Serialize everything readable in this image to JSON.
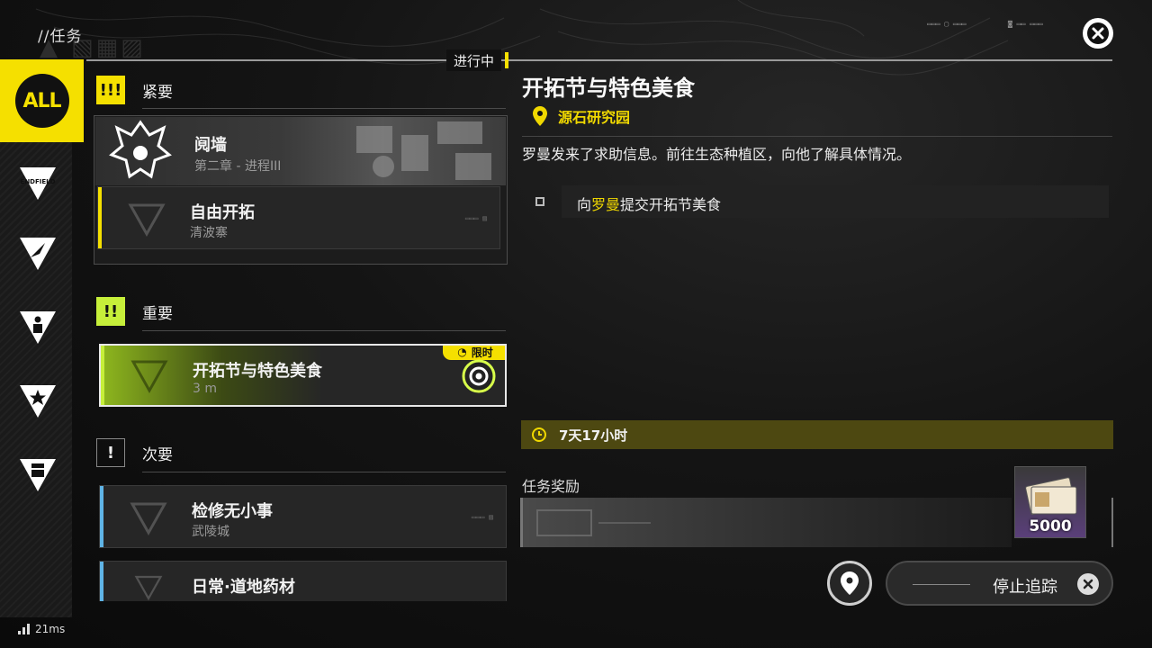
{
  "header": {
    "title": "//任务",
    "close_icon": "close-x-icon"
  },
  "status": {
    "in_progress": "进行中",
    "ping": "21ms"
  },
  "sidebar": {
    "all_label": "ALL",
    "items": [
      {
        "name": "endfield",
        "label": "ENDFIELD",
        "icon": "endfield-icon"
      },
      {
        "name": "explore",
        "icon": "compass-icon"
      },
      {
        "name": "character",
        "icon": "person-icon"
      },
      {
        "name": "event",
        "icon": "star-icon"
      },
      {
        "name": "daily",
        "icon": "box-icon"
      }
    ]
  },
  "groups": {
    "urgent": {
      "badge": "!!!",
      "label": "紧要"
    },
    "important": {
      "badge": "!!",
      "label": "重要"
    },
    "minor": {
      "badge": "!",
      "label": "次要"
    }
  },
  "quests": {
    "urgent_main": {
      "title": "阋墙",
      "subtitle": "第二章 - 进程III"
    },
    "urgent_sub": {
      "title": "自由开拓",
      "subtitle": "清波寨"
    },
    "important_1": {
      "title": "开拓节与特色美食",
      "subtitle": "3 m",
      "tag": "限时"
    },
    "minor_1": {
      "title": "检修无小事",
      "subtitle": "武陵城"
    },
    "minor_2": {
      "title": "日常·道地药材"
    }
  },
  "detail": {
    "title": "开拓节与特色美食",
    "location": "源石研究园",
    "description": "罗曼发来了求助信息。前往生态种植区，向他了解具体情况。",
    "objective_pre": "向",
    "objective_hl": "罗曼",
    "objective_post": "提交开拓节美食",
    "timer": "7天17小时",
    "reward_label": "任务奖励",
    "reward_qty": "5000"
  },
  "actions": {
    "stop_tracking": "停止追踪"
  },
  "colors": {
    "accent_yellow": "#f5e000",
    "lime": "#c6ef3a",
    "minor_blue": "#5fb4e6"
  }
}
